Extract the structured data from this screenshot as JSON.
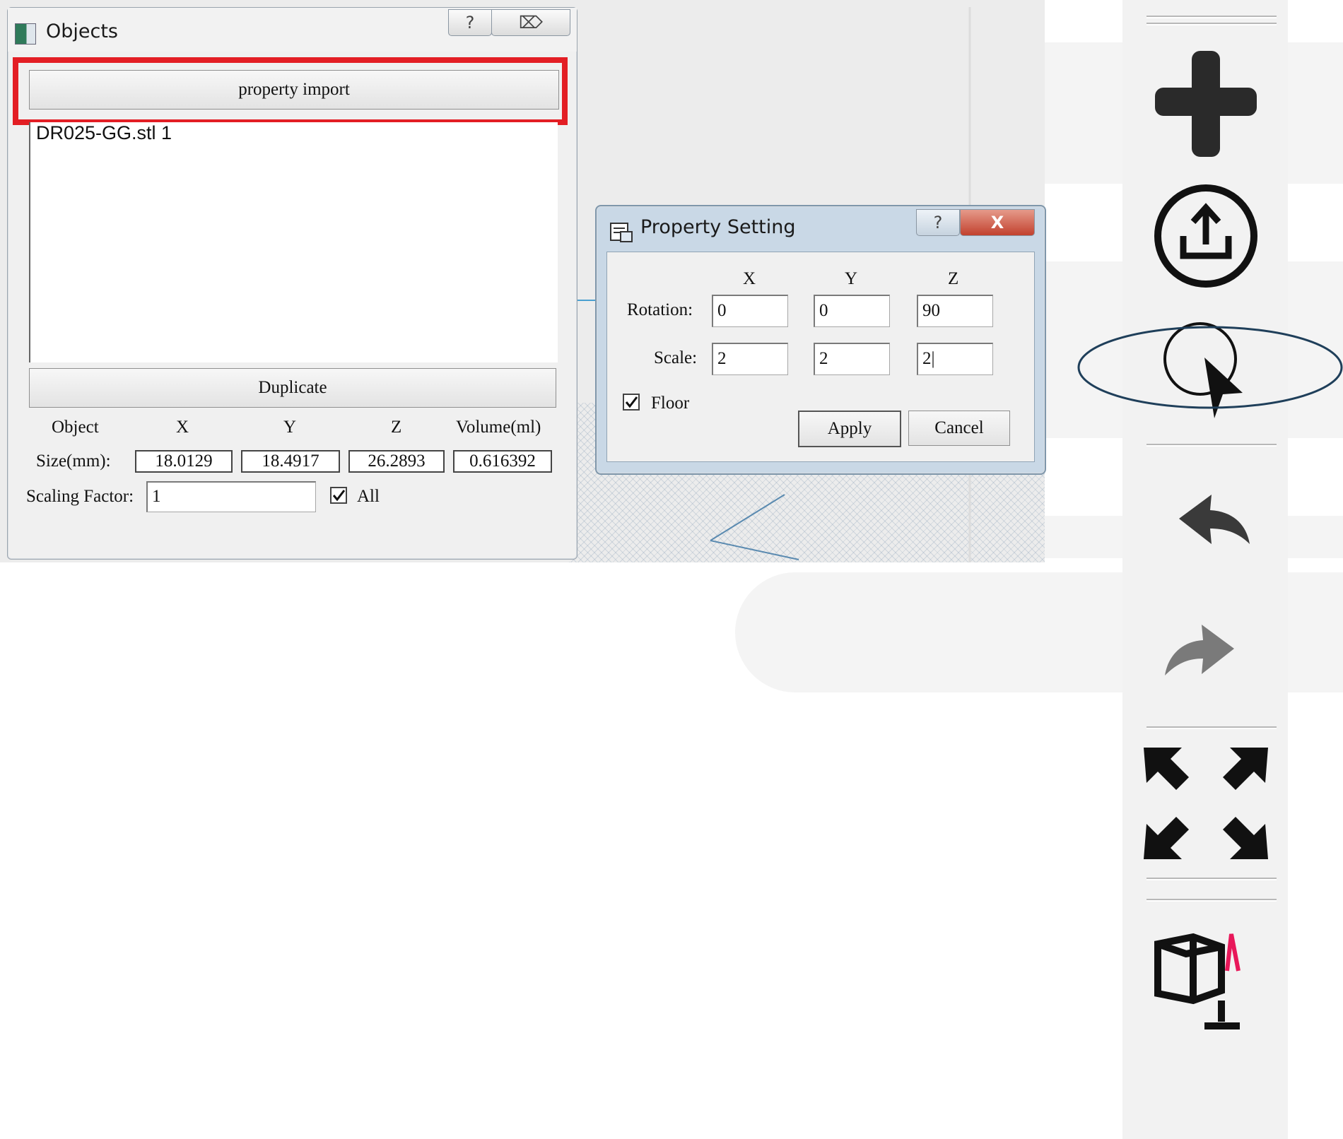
{
  "objects_window": {
    "title": "Objects",
    "help_label": "?",
    "close_label": "⌦",
    "property_import_label": "property import",
    "list_items": [
      "DR025-GG.stl 1"
    ],
    "duplicate_label": "Duplicate",
    "columns": [
      "Object",
      "X",
      "Y",
      "Z",
      "Volume(ml)"
    ],
    "size_label": "Size(mm):",
    "size_values": [
      "18.0129",
      "18.4917",
      "26.2893",
      "0.616392"
    ],
    "scaling_factor_label": "Scaling Factor:",
    "scaling_factor_value": "1",
    "all_label": "All",
    "all_checked": true
  },
  "property_dialog": {
    "title": "Property Setting",
    "help_label": "?",
    "close_label": "X",
    "axis_headers": [
      "X",
      "Y",
      "Z"
    ],
    "rotation_label": "Rotation:",
    "rotation_values": [
      "0",
      "0",
      "90"
    ],
    "scale_label": "Scale:",
    "scale_values": [
      "2",
      "2",
      "2|"
    ],
    "floor_label": "Floor",
    "floor_checked": true,
    "apply_label": "Apply",
    "cancel_label": "Cancel"
  },
  "toolbar": {
    "icons": [
      "add-icon",
      "export-icon",
      "select-rotate-icon",
      "undo-icon",
      "redo-icon",
      "fit-view-icon",
      "view-cube-icon"
    ]
  },
  "colors": {
    "highlight": "#e31e24",
    "ellipse": "#1f3f5a",
    "accent_pink": "#e8185a"
  }
}
